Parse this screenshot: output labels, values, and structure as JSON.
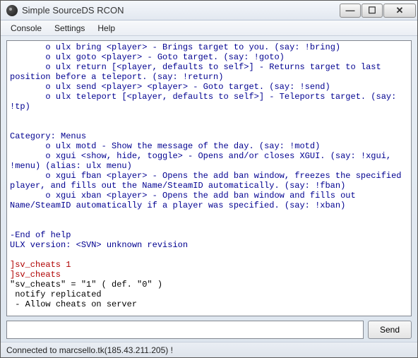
{
  "window": {
    "title": "Simple SourceDS RCON"
  },
  "menu": {
    "console": "Console",
    "settings": "Settings",
    "help": "Help"
  },
  "console": {
    "help_block": "       o ulx bring <player> - Brings target to you. (say: !bring)\n       o ulx goto <player> - Goto target. (say: !goto)\n       o ulx return [<player, defaults to self>] - Returns target to last position before a teleport. (say: !return)\n       o ulx send <player> <player> - Goto target. (say: !send)\n       o ulx teleport [<player, defaults to self>] - Teleports target. (say: !tp)\n\n\nCategory: Menus\n       o ulx motd - Show the message of the day. (say: !motd)\n       o xgui <show, hide, toggle> - Opens and/or closes XGUI. (say: !xgui, !menu) (alias: ulx menu)\n       o xgui fban <player> - Opens the add ban window, freezes the specified player, and fills out the Name/SteamID automatically. (say: !fban)\n       o xgui xban <player> - Opens the add ban window and fills out Name/SteamID automatically if a player was specified. (say: !xban)\n\n\n-End of help\nULX version: <SVN> unknown revision\n",
    "cmd1": "]sv_cheats 1",
    "cmd2": "]sv_cheats",
    "resp": "\"sv_cheats\" = \"1\" ( def. \"0\" )\n notify replicated\n - Allow cheats on server"
  },
  "input": {
    "value": "",
    "send_label": "Send"
  },
  "status": {
    "text": "Connected to marcsello.tk(185.43.211.205) !"
  }
}
